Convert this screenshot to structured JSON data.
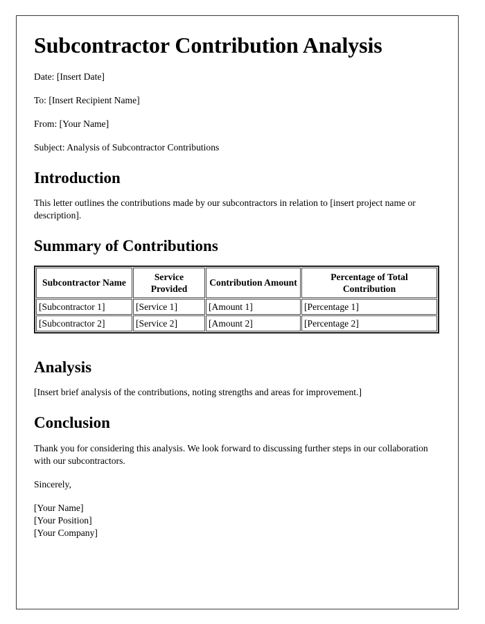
{
  "document": {
    "title": "Subcontractor Contribution Analysis",
    "meta": [
      "Date: [Insert Date]",
      "To: [Insert Recipient Name]",
      "From: [Your Name]",
      "Subject: Analysis of Subcontractor Contributions"
    ],
    "sections": {
      "introduction": {
        "heading": "Introduction",
        "body": "This letter outlines the contributions made by our subcontractors in relation to [insert project name or description]."
      },
      "summary": {
        "heading": "Summary of Contributions"
      },
      "analysis": {
        "heading": "Analysis",
        "body": "[Insert brief analysis of the contributions, noting strengths and areas for improvement.]"
      },
      "conclusion": {
        "heading": "Conclusion",
        "body": "Thank you for considering this analysis. We look forward to discussing further steps in our collaboration with our subcontractors.",
        "closing": "Sincerely,",
        "signature": "[Your Name]\n[Your Position]\n[Your Company]"
      }
    },
    "table": {
      "headers": [
        "Subcontractor Name",
        "Service Provided",
        "Contribution Amount",
        "Percentage of Total Contribution"
      ],
      "rows": [
        [
          "[Subcontractor 1]",
          "[Service 1]",
          "[Amount 1]",
          "[Percentage 1]"
        ],
        [
          "[Subcontractor 2]",
          "[Service 2]",
          "[Amount 2]",
          "[Percentage 2]"
        ]
      ]
    },
    "colors": {
      "text": "#000000",
      "page_border": "#3a3a3a",
      "table_outer_border": "#1d1d1d",
      "table_cell_border": "#4a4a4a",
      "background": "#ffffff"
    }
  }
}
